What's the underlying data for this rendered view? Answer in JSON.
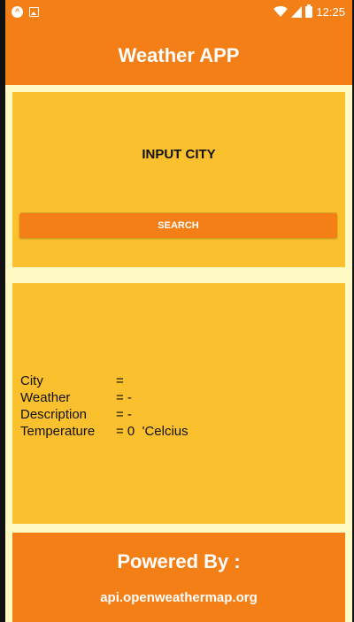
{
  "status_bar": {
    "time": "12:25",
    "icons": [
      "app-notification-icon",
      "image-notification-icon",
      "wifi-icon",
      "signal-icon",
      "battery-icon"
    ]
  },
  "app_bar": {
    "title": "Weather APP"
  },
  "input_card": {
    "label": "INPUT CITY",
    "city_value": "",
    "search_label": "SEARCH"
  },
  "results": [
    {
      "key": "City",
      "value": "="
    },
    {
      "key": "Weather",
      "value": "= -"
    },
    {
      "key": "Description",
      "value": "= -"
    },
    {
      "key": "Temperature",
      "value": "= 0  'Celcius"
    }
  ],
  "footer": {
    "title": "Powered By :",
    "link": "api.openweathermap.org"
  },
  "colors": {
    "primary": "#F57F17",
    "card": "#FBC02D",
    "background": "#FFF9C4"
  }
}
